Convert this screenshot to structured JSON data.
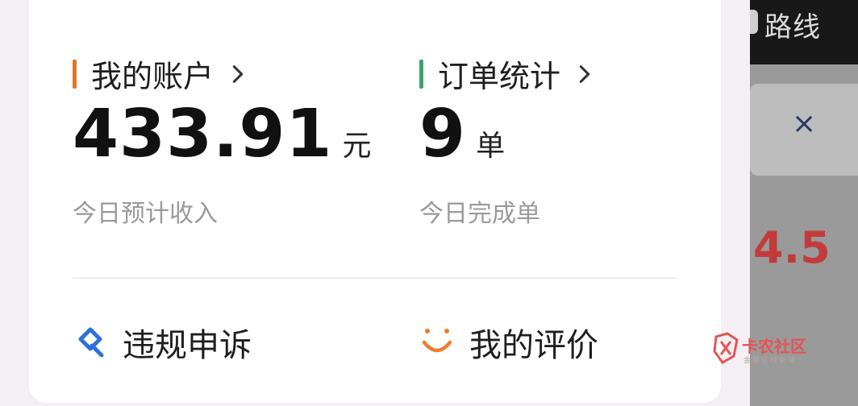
{
  "side": {
    "route_label": "路线",
    "close_glyph": "×",
    "number": "4.5"
  },
  "account": {
    "title": "我的账户",
    "value": "433.91",
    "unit": "元",
    "subtitle": "今日预计收入",
    "accent": "#e0772b"
  },
  "orders": {
    "title": "订单统计",
    "value": "9",
    "unit": "单",
    "subtitle": "今日完成单",
    "accent": "#3fa36a"
  },
  "actions": [
    {
      "label": "违规申诉",
      "icon": "appeal-icon",
      "color": "#2f6fe0"
    },
    {
      "label": "我的评价",
      "icon": "smile-icon",
      "color": "#f07a2b"
    }
  ],
  "watermark": {
    "title": "卡农社区",
    "subtitle": "金融在线新闻"
  }
}
